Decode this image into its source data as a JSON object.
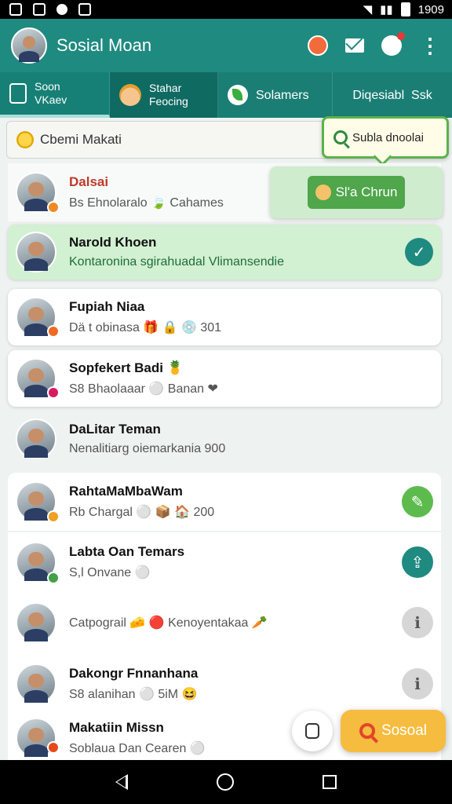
{
  "status_bar": {
    "time": "1909"
  },
  "app_bar": {
    "title": "Sosial Moan"
  },
  "tabs": [
    {
      "label": "Soon\nVKaev"
    },
    {
      "label": "Stahar\nFeocing"
    },
    {
      "label": "Solamers"
    },
    {
      "label": "Diqesiabl  Ssk"
    }
  ],
  "search": {
    "value": "Cbemi Makati"
  },
  "tooltip": {
    "label": "Subla dnoolai"
  },
  "overlay": {
    "button_label": "Sl'a  Chrun"
  },
  "rows": [
    {
      "name": "Dalsai",
      "subtitle": "Bs Ehnolaralo  🍃  Cahames"
    },
    {
      "name": "Narold Khoen",
      "subtitle": "Kontaronina sgirahuadal Vlimansendie"
    },
    {
      "name": "Fupiah Niaa",
      "subtitle": "Dä t obinasa  🎁 🔒 💿 301"
    },
    {
      "name": "Sopfekert Badi 🍍",
      "subtitle": "S8 Bhaolaaar  ⚪  Banan ❤"
    },
    {
      "name": "DaLitar Teman",
      "subtitle": "Nenalitiarg oiemarkania 900"
    },
    {
      "name": "RahtaMaMbaWam",
      "subtitle": "Rb Chargal ⚪ 📦 🏠 200"
    },
    {
      "name": "Labta Oan Temars",
      "subtitle": "S,l Onvane  ⚪"
    },
    {
      "name": "",
      "subtitle": "Catpograil  🧀  🔴  Kenoyentakaa  🥕"
    },
    {
      "name": "Dakongr Fnnanhana",
      "subtitle": "S8 alanihan  ⚪  5iM 😆"
    },
    {
      "name": "Makatiin Missn",
      "subtitle": "Soblaua Dan Cearen  ⚪"
    }
  ],
  "fab": {
    "label": "Sosoal"
  },
  "colors": {
    "primary": "#1f8a80",
    "accent_green": "#4fa64b",
    "fab_yellow": "#f6bc3f",
    "selected_row": "#d2f0d2"
  }
}
